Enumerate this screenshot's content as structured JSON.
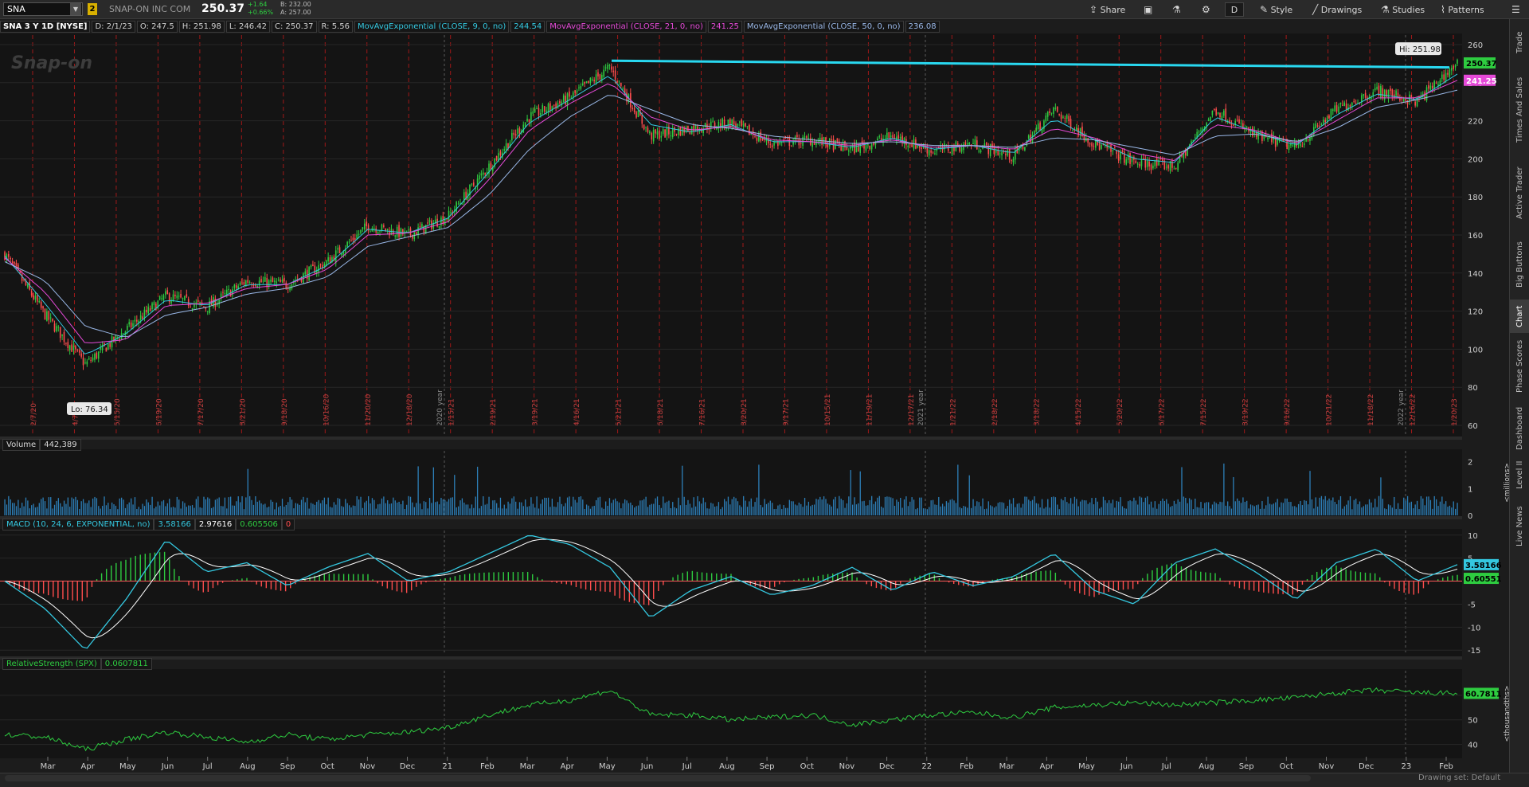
{
  "header": {
    "symbol": "SNA",
    "link_badge": "2",
    "company": "SNAP-ON INC COM",
    "last": "250.37",
    "change_abs": "+1.64",
    "change_pct": "+0.66%",
    "bid": "B: 232.00",
    "ask": "A: 257.00",
    "buttons": {
      "share": "Share",
      "period": "D",
      "style": "Style",
      "drawings": "Drawings",
      "studies": "Studies",
      "patterns": "Patterns"
    }
  },
  "infoline": {
    "title": "SNA 3 Y 1D [NYSE]",
    "date": "D: 2/1/23",
    "open": "O: 247.5",
    "high": "H: 251.98",
    "low": "L: 246.42",
    "close": "C: 250.37",
    "range": "R: 5.56",
    "ema9_label": "MovAvgExponential (CLOSE, 9, 0, no)",
    "ema9_value": "244.54",
    "ema21_label": "MovAvgExponential (CLOSE, 21, 0, no)",
    "ema21_value": "241.25",
    "ema50_label": "MovAvgExponential (CLOSE, 50, 0, no)",
    "ema50_value": "236.08"
  },
  "price_pane": {
    "watermark": "Snap-on",
    "hi_label": "Hi: 251.98",
    "lo_label": "Lo: 76.34",
    "last_tag": "250.37",
    "ema_tag": "241.25",
    "year_markers": [
      "2020 year",
      "2021 year",
      "2022 year"
    ],
    "event_dates": [
      "2/7/20",
      "4/7/20",
      "5/15/20",
      "6/19/20",
      "7/17/20",
      "8/21/20",
      "9/18/20",
      "10/16/20",
      "11/20/20",
      "12/18/20",
      "1/15/21",
      "2/19/21",
      "3/19/21",
      "4/16/21",
      "5/21/21",
      "6/18/21",
      "7/16/21",
      "8/20/21",
      "9/17/21",
      "10/15/21",
      "11/19/21",
      "12/17/21",
      "1/21/22",
      "2/18/22",
      "3/18/22",
      "4/15/22",
      "5/20/22",
      "6/17/22",
      "7/15/22",
      "8/19/22",
      "9/16/22",
      "10/21/22",
      "11/18/22",
      "12/16/22",
      "1/20/23"
    ],
    "y_ticks": [
      "260",
      "240",
      "220",
      "200",
      "180",
      "160",
      "140",
      "120",
      "100",
      "80",
      "60"
    ]
  },
  "volume_pane": {
    "label": "Volume",
    "value": "442,389",
    "y_ticks": [
      "2",
      "1",
      "0"
    ],
    "unit": "<millions>"
  },
  "macd_pane": {
    "label": "MACD (10, 24, 6, EXPONENTIAL, no)",
    "value": "3.58166",
    "avg": "2.97616",
    "diff": "0.605506",
    "zero": "0",
    "tag_value": "3.58166",
    "tag_diff": "0.60551",
    "y_ticks": [
      "10",
      "5",
      "-5",
      "-10",
      "-15"
    ]
  },
  "rs_pane": {
    "label": "RelativeStrength (SPX)",
    "value": "0.0607811",
    "tag": "60.7811",
    "y_ticks": [
      "60",
      "50",
      "40"
    ],
    "unit": "<thousandths>"
  },
  "x_axis": [
    "Mar",
    "Apr",
    "May",
    "Jun",
    "Jul",
    "Aug",
    "Sep",
    "Oct",
    "Nov",
    "Dec",
    "21",
    "Feb",
    "Mar",
    "Apr",
    "May",
    "Jun",
    "Jul",
    "Aug",
    "Sep",
    "Oct",
    "Nov",
    "Dec",
    "22",
    "Feb",
    "Mar",
    "Apr",
    "May",
    "Jun",
    "Jul",
    "Aug",
    "Sep",
    "Oct",
    "Nov",
    "Dec",
    "23",
    "Feb"
  ],
  "side_tabs": [
    "Trade",
    "Times And Sales",
    "Active Trader",
    "Big Buttons",
    "Chart",
    "Phase Scores",
    "Dashboard",
    "Level II",
    "Live News"
  ],
  "footer": {
    "drawing_set": "Drawing set: Default"
  },
  "colors": {
    "up": "#2ecc40",
    "down": "#ff4d4d",
    "ema9": "#34c8e0",
    "ema21": "#e64ad9",
    "ema50": "#9ab8e8",
    "trendline": "#29d8f0",
    "macd_avg": "#ffffff",
    "rs": "#2ecc40"
  },
  "chart_data": {
    "type": "line",
    "title": "SNA 3 Y 1D [NYSE]",
    "x": [
      "2020-02",
      "2020-03",
      "2020-04",
      "2020-05",
      "2020-06",
      "2020-07",
      "2020-08",
      "2020-09",
      "2020-10",
      "2020-11",
      "2020-12",
      "2021-01",
      "2021-02",
      "2021-03",
      "2021-04",
      "2021-05",
      "2021-06",
      "2021-07",
      "2021-08",
      "2021-09",
      "2021-10",
      "2021-11",
      "2021-12",
      "2022-01",
      "2022-02",
      "2022-03",
      "2022-04",
      "2022-05",
      "2022-06",
      "2022-07",
      "2022-08",
      "2022-09",
      "2022-10",
      "2022-11",
      "2022-12",
      "2023-01",
      "2023-02"
    ],
    "ylim": [
      55,
      265
    ],
    "series": [
      {
        "name": "SNA",
        "values": [
          150,
          118,
          92,
          110,
          128,
          122,
          136,
          134,
          146,
          165,
          160,
          170,
          196,
          222,
          232,
          248,
          212,
          216,
          219,
          208,
          210,
          205,
          212,
          204,
          208,
          201,
          226,
          208,
          198,
          196,
          226,
          212,
          206,
          226,
          236,
          230,
          250.37
        ]
      },
      {
        "name": "MovAvgExponential (CLOSE, 9, 0, no)",
        "values": [
          149,
          124,
          97,
          108,
          126,
          123,
          134,
          134,
          144,
          163,
          161,
          169,
          193,
          219,
          231,
          244,
          218,
          214,
          218,
          209,
          209,
          206,
          211,
          205,
          207,
          203,
          221,
          210,
          200,
          198,
          222,
          214,
          207,
          223,
          234,
          231,
          244.54
        ]
      },
      {
        "name": "MovAvgExponential (CLOSE, 21, 0, no)",
        "values": [
          148,
          130,
          103,
          105,
          123,
          124,
          132,
          134,
          142,
          160,
          161,
          167,
          189,
          215,
          229,
          240,
          222,
          215,
          217,
          210,
          209,
          207,
          210,
          206,
          207,
          205,
          216,
          211,
          203,
          199,
          218,
          215,
          208,
          220,
          232,
          232,
          241.25
        ]
      },
      {
        "name": "MovAvgExponential (CLOSE, 50, 0, no)",
        "values": [
          146,
          136,
          112,
          106,
          118,
          122,
          129,
          132,
          138,
          154,
          159,
          164,
          181,
          205,
          222,
          234,
          226,
          218,
          216,
          212,
          210,
          208,
          209,
          207,
          207,
          206,
          211,
          210,
          206,
          202,
          212,
          213,
          209,
          216,
          227,
          231,
          236.08
        ]
      }
    ],
    "hi": 251.98,
    "lo": 76.34,
    "trendline": [
      251.5,
      248.0
    ],
    "volume": {
      "ylim": [
        0,
        2.4
      ],
      "avg": 0.45
    },
    "macd": {
      "ylim": [
        -16,
        11
      ],
      "values": [
        0,
        -6,
        -15,
        -4,
        9,
        2,
        4,
        -1,
        3,
        6,
        0,
        2,
        6,
        10,
        8,
        3,
        -8,
        -2,
        1,
        -3,
        -1,
        3,
        -2,
        2,
        -1,
        1,
        6,
        -2,
        -5,
        4,
        7,
        2,
        -4,
        4,
        7,
        0,
        3.58166
      ],
      "avg": 2.97616,
      "diff": 0.605506
    },
    "relative_strength": {
      "ylim": [
        35,
        70
      ],
      "values": [
        44,
        43,
        38,
        42,
        45,
        43,
        41,
        44,
        42,
        44,
        45,
        47,
        52,
        56,
        58,
        62,
        52,
        52,
        50,
        51,
        52,
        48,
        50,
        52,
        53,
        51,
        55,
        56,
        57,
        56,
        57,
        58,
        59,
        61,
        62,
        61,
        60.78
      ]
    },
    "xlabel": "",
    "ylabel": ""
  }
}
